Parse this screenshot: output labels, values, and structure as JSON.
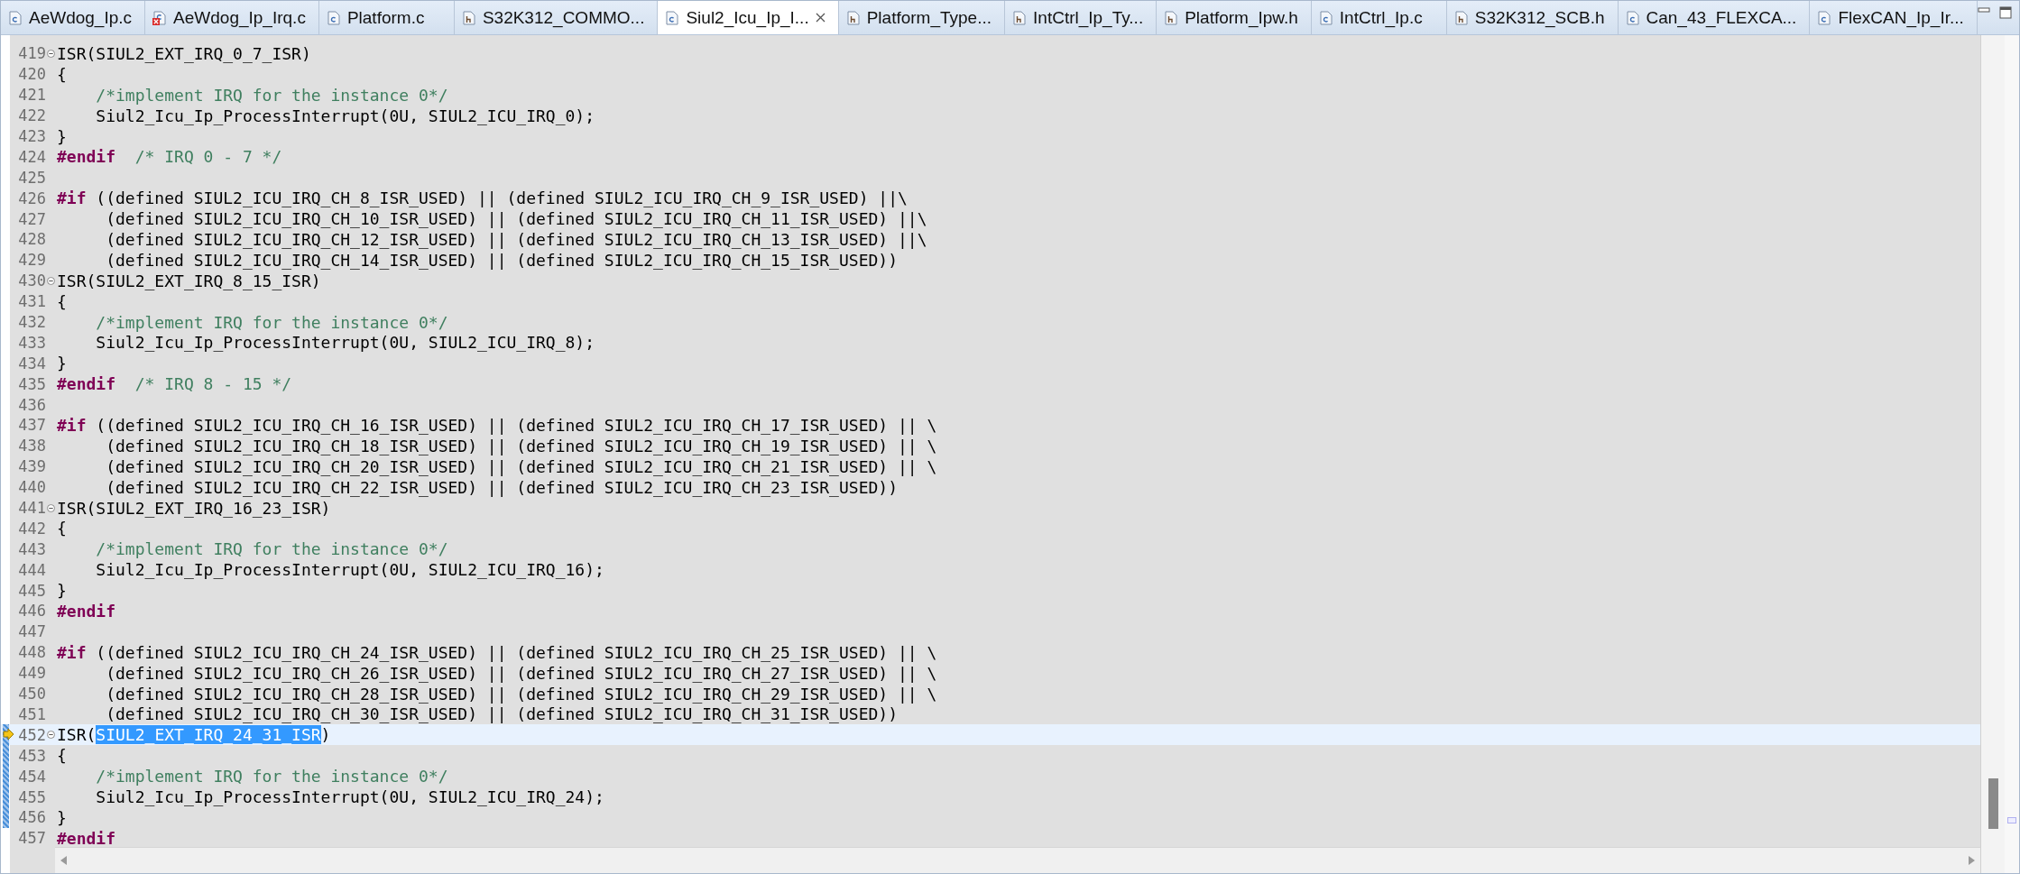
{
  "tabs": [
    {
      "label": "AeWdog_Ip.c",
      "kind": "c",
      "selected": false
    },
    {
      "label": "AeWdog_Ip_Irq.c",
      "kind": "c-error",
      "selected": false
    },
    {
      "label": "Platform.c",
      "kind": "c",
      "selected": false
    },
    {
      "label": "S32K312_COMMO...",
      "kind": "h",
      "selected": false
    },
    {
      "label": "Siul2_Icu_Ip_I...",
      "kind": "c",
      "selected": true
    },
    {
      "label": "Platform_Type...",
      "kind": "h",
      "selected": false
    },
    {
      "label": "IntCtrl_Ip_Ty...",
      "kind": "h",
      "selected": false
    },
    {
      "label": "Platform_Ipw.h",
      "kind": "h",
      "selected": false
    },
    {
      "label": "IntCtrl_Ip.c",
      "kind": "c",
      "selected": false
    },
    {
      "label": "S32K312_SCB.h",
      "kind": "h",
      "selected": false
    },
    {
      "label": "Can_43_FLEXCA...",
      "kind": "c",
      "selected": false
    },
    {
      "label": "FlexCAN_Ip_Ir...",
      "kind": "c",
      "selected": false
    }
  ],
  "lines": [
    {
      "number": "419",
      "fold": true,
      "current": false,
      "changed": false,
      "segments": [
        {
          "kind": "code",
          "text": "ISR(SIUL2_EXT_IRQ_0_7_ISR)"
        }
      ]
    },
    {
      "number": "420",
      "fold": false,
      "current": false,
      "changed": false,
      "segments": [
        {
          "kind": "code",
          "text": "{"
        }
      ]
    },
    {
      "number": "421",
      "fold": false,
      "current": false,
      "changed": false,
      "segments": [
        {
          "kind": "comment",
          "text": "    /*implement IRQ for the instance 0*/"
        }
      ]
    },
    {
      "number": "422",
      "fold": false,
      "current": false,
      "changed": false,
      "segments": [
        {
          "kind": "code",
          "text": "    Siul2_Icu_Ip_ProcessInterrupt(0U, SIUL2_ICU_IRQ_0);"
        }
      ]
    },
    {
      "number": "423",
      "fold": false,
      "current": false,
      "changed": false,
      "segments": [
        {
          "kind": "code",
          "text": "}"
        }
      ]
    },
    {
      "number": "424",
      "fold": false,
      "current": false,
      "changed": false,
      "segments": [
        {
          "kind": "keyword",
          "text": "#endif"
        },
        {
          "kind": "comment",
          "text": "  /* IRQ 0 - 7 */"
        }
      ]
    },
    {
      "number": "425",
      "fold": false,
      "current": false,
      "changed": false
    },
    {
      "number": "426",
      "fold": false,
      "current": false,
      "changed": false,
      "segments": [
        {
          "kind": "keyword",
          "text": "#if"
        },
        {
          "kind": "code",
          "text": " ((defined SIUL2_ICU_IRQ_CH_8_ISR_USED) || (defined SIUL2_ICU_IRQ_CH_9_ISR_USED) ||\\"
        }
      ]
    },
    {
      "number": "427",
      "fold": false,
      "current": false,
      "changed": false,
      "segments": [
        {
          "kind": "code",
          "text": "     (defined SIUL2_ICU_IRQ_CH_10_ISR_USED) || (defined SIUL2_ICU_IRQ_CH_11_ISR_USED) ||\\"
        }
      ]
    },
    {
      "number": "428",
      "fold": false,
      "current": false,
      "changed": false,
      "segments": [
        {
          "kind": "code",
          "text": "     (defined SIUL2_ICU_IRQ_CH_12_ISR_USED) || (defined SIUL2_ICU_IRQ_CH_13_ISR_USED) ||\\"
        }
      ]
    },
    {
      "number": "429",
      "fold": false,
      "current": false,
      "changed": false,
      "segments": [
        {
          "kind": "code",
          "text": "     (defined SIUL2_ICU_IRQ_CH_14_ISR_USED) || (defined SIUL2_ICU_IRQ_CH_15_ISR_USED))"
        }
      ]
    },
    {
      "number": "430",
      "fold": true,
      "current": false,
      "changed": false,
      "segments": [
        {
          "kind": "code",
          "text": "ISR(SIUL2_EXT_IRQ_8_15_ISR)"
        }
      ]
    },
    {
      "number": "431",
      "fold": false,
      "current": false,
      "changed": false,
      "segments": [
        {
          "kind": "code",
          "text": "{"
        }
      ]
    },
    {
      "number": "432",
      "fold": false,
      "current": false,
      "changed": false,
      "segments": [
        {
          "kind": "comment",
          "text": "    /*implement IRQ for the instance 0*/"
        }
      ]
    },
    {
      "number": "433",
      "fold": false,
      "current": false,
      "changed": false,
      "segments": [
        {
          "kind": "code",
          "text": "    Siul2_Icu_Ip_ProcessInterrupt(0U, SIUL2_ICU_IRQ_8);"
        }
      ]
    },
    {
      "number": "434",
      "fold": false,
      "current": false,
      "changed": false,
      "segments": [
        {
          "kind": "code",
          "text": "}"
        }
      ]
    },
    {
      "number": "435",
      "fold": false,
      "current": false,
      "changed": false,
      "segments": [
        {
          "kind": "keyword",
          "text": "#endif"
        },
        {
          "kind": "comment",
          "text": "  /* IRQ 8 - 15 */"
        }
      ]
    },
    {
      "number": "436",
      "fold": false,
      "current": false,
      "changed": false
    },
    {
      "number": "437",
      "fold": false,
      "current": false,
      "changed": false,
      "segments": [
        {
          "kind": "keyword",
          "text": "#if"
        },
        {
          "kind": "code",
          "text": " ((defined SIUL2_ICU_IRQ_CH_16_ISR_USED) || (defined SIUL2_ICU_IRQ_CH_17_ISR_USED) || \\"
        }
      ]
    },
    {
      "number": "438",
      "fold": false,
      "current": false,
      "changed": false,
      "segments": [
        {
          "kind": "code",
          "text": "     (defined SIUL2_ICU_IRQ_CH_18_ISR_USED) || (defined SIUL2_ICU_IRQ_CH_19_ISR_USED) || \\"
        }
      ]
    },
    {
      "number": "439",
      "fold": false,
      "current": false,
      "changed": false,
      "segments": [
        {
          "kind": "code",
          "text": "     (defined SIUL2_ICU_IRQ_CH_20_ISR_USED) || (defined SIUL2_ICU_IRQ_CH_21_ISR_USED) || \\"
        }
      ]
    },
    {
      "number": "440",
      "fold": false,
      "current": false,
      "changed": false,
      "segments": [
        {
          "kind": "code",
          "text": "     (defined SIUL2_ICU_IRQ_CH_22_ISR_USED) || (defined SIUL2_ICU_IRQ_CH_23_ISR_USED))"
        }
      ]
    },
    {
      "number": "441",
      "fold": true,
      "current": false,
      "changed": false,
      "segments": [
        {
          "kind": "code",
          "text": "ISR(SIUL2_EXT_IRQ_16_23_ISR)"
        }
      ]
    },
    {
      "number": "442",
      "fold": false,
      "current": false,
      "changed": false,
      "segments": [
        {
          "kind": "code",
          "text": "{"
        }
      ]
    },
    {
      "number": "443",
      "fold": false,
      "current": false,
      "changed": false,
      "segments": [
        {
          "kind": "comment",
          "text": "    /*implement IRQ for the instance 0*/"
        }
      ]
    },
    {
      "number": "444",
      "fold": false,
      "current": false,
      "changed": false,
      "segments": [
        {
          "kind": "code",
          "text": "    Siul2_Icu_Ip_ProcessInterrupt(0U, SIUL2_ICU_IRQ_16);"
        }
      ]
    },
    {
      "number": "445",
      "fold": false,
      "current": false,
      "changed": false,
      "segments": [
        {
          "kind": "code",
          "text": "}"
        }
      ]
    },
    {
      "number": "446",
      "fold": false,
      "current": false,
      "changed": false,
      "segments": [
        {
          "kind": "keyword",
          "text": "#endif"
        }
      ]
    },
    {
      "number": "447",
      "fold": false,
      "current": false,
      "changed": false
    },
    {
      "number": "448",
      "fold": false,
      "current": false,
      "changed": false,
      "segments": [
        {
          "kind": "keyword",
          "text": "#if"
        },
        {
          "kind": "code",
          "text": " ((defined SIUL2_ICU_IRQ_CH_24_ISR_USED) || (defined SIUL2_ICU_IRQ_CH_25_ISR_USED) || \\"
        }
      ]
    },
    {
      "number": "449",
      "fold": false,
      "current": false,
      "changed": false,
      "segments": [
        {
          "kind": "code",
          "text": "     (defined SIUL2_ICU_IRQ_CH_26_ISR_USED) || (defined SIUL2_ICU_IRQ_CH_27_ISR_USED) || \\"
        }
      ]
    },
    {
      "number": "450",
      "fold": false,
      "current": false,
      "changed": false,
      "segments": [
        {
          "kind": "code",
          "text": "     (defined SIUL2_ICU_IRQ_CH_28_ISR_USED) || (defined SIUL2_ICU_IRQ_CH_29_ISR_USED) || \\"
        }
      ]
    },
    {
      "number": "451",
      "fold": false,
      "current": false,
      "changed": false,
      "segments": [
        {
          "kind": "code",
          "text": "     (defined SIUL2_ICU_IRQ_CH_30_ISR_USED) || (defined SIUL2_ICU_IRQ_CH_31_ISR_USED))"
        }
      ]
    },
    {
      "number": "452",
      "fold": true,
      "current": true,
      "changed": true,
      "segments": [
        {
          "kind": "code",
          "text": "ISR("
        },
        {
          "kind": "selection",
          "text": "SIUL2_EXT_IRQ_24_31_ISR"
        },
        {
          "kind": "code",
          "text": ")"
        }
      ]
    },
    {
      "number": "453",
      "fold": false,
      "current": false,
      "changed": true,
      "segments": [
        {
          "kind": "code",
          "text": "{"
        }
      ]
    },
    {
      "number": "454",
      "fold": false,
      "current": false,
      "changed": true,
      "segments": [
        {
          "kind": "comment",
          "text": "    /*implement IRQ for the instance 0*/"
        }
      ]
    },
    {
      "number": "455",
      "fold": false,
      "current": false,
      "changed": true,
      "segments": [
        {
          "kind": "code",
          "text": "    Siul2_Icu_Ip_ProcessInterrupt(0U, SIUL2_ICU_IRQ_24);"
        }
      ]
    },
    {
      "number": "456",
      "fold": false,
      "current": false,
      "changed": true,
      "segments": [
        {
          "kind": "code",
          "text": "}"
        }
      ]
    },
    {
      "number": "457",
      "fold": false,
      "current": false,
      "changed": false,
      "segments": [
        {
          "kind": "keyword",
          "text": "#endif"
        }
      ]
    }
  ]
}
